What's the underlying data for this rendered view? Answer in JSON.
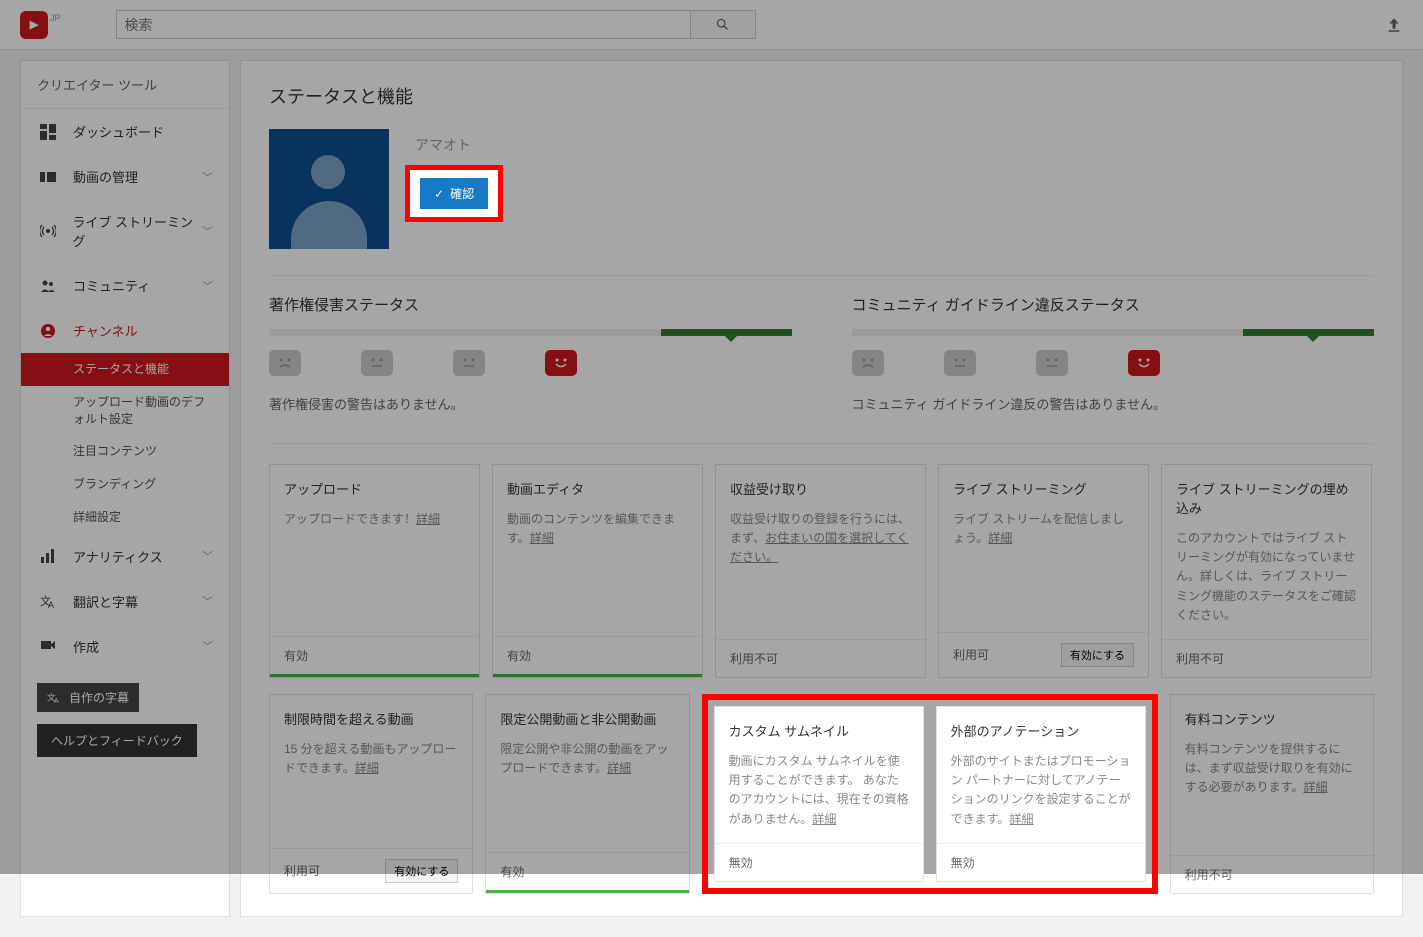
{
  "header": {
    "country": "JP",
    "search_placeholder": "検索"
  },
  "sidebar": {
    "title": "クリエイター ツール",
    "items": [
      {
        "label": "ダッシュボード"
      },
      {
        "label": "動画の管理"
      },
      {
        "label": "ライブ ストリーミング"
      },
      {
        "label": "コミュニティ"
      },
      {
        "label": "チャンネル"
      },
      {
        "label": "アナリティクス"
      },
      {
        "label": "翻訳と字幕"
      },
      {
        "label": "作成"
      }
    ],
    "channel_sub": [
      "ステータスと機能",
      "アップロード動画のデフォルト設定",
      "注目コンテンツ",
      "ブランディング",
      "詳細設定"
    ],
    "own_subs": "自作の字幕",
    "help": "ヘルプとフィードバック"
  },
  "main": {
    "title": "ステータスと機能",
    "username": "アマオト",
    "verify": "確認",
    "copyright": {
      "title": "著作権侵害ステータス",
      "msg": "著作権侵害の警告はありません。"
    },
    "community": {
      "title": "コミュニティ ガイドライン違反ステータス",
      "msg": "コミュニティ ガイドライン違反の警告はありません。"
    },
    "features_row1": [
      {
        "title": "アップロード",
        "desc": "アップロードできます！",
        "link": "詳細",
        "status": "有効",
        "enabled": true,
        "btn": ""
      },
      {
        "title": "動画エディタ",
        "desc": "動画のコンテンツを編集できます。",
        "link": "詳細",
        "status": "有効",
        "enabled": true,
        "btn": ""
      },
      {
        "title": "収益受け取り",
        "desc": "収益受け取りの登録を行うには、まず、",
        "link": "お住まいの国を選択してください。",
        "status": "利用不可",
        "enabled": false,
        "btn": ""
      },
      {
        "title": "ライブ ストリーミング",
        "desc": "ライブ ストリームを配信しましょう。",
        "link": "詳細",
        "status": "利用可",
        "enabled": false,
        "btn": "有効にする"
      },
      {
        "title": "ライブ ストリーミングの埋め込み",
        "desc": "このアカウントではライブ ストリーミングが有効になっていません。詳しくは、ライブ ストリーミング機能のステータスをご確認ください。",
        "link": "",
        "status": "利用不可",
        "enabled": false,
        "btn": ""
      }
    ],
    "features_row2_left": [
      {
        "title": "制限時間を超える動画",
        "desc": "15 分を超える動画もアップロードできます。",
        "link": "詳細",
        "status": "利用可",
        "enabled": false,
        "btn": "有効にする"
      },
      {
        "title": "限定公開動画と非公開動画",
        "desc": "限定公開や非公開の動画をアップロードできます。",
        "link": "詳細",
        "status": "有効",
        "enabled": true,
        "btn": ""
      }
    ],
    "features_callout": [
      {
        "title": "カスタム サムネイル",
        "desc": "動画にカスタム サムネイルを使用することができます。\nあなたのアカウントには、現在その資格がありません。",
        "link": "詳細",
        "status": "無効"
      },
      {
        "title": "外部のアノテーション",
        "desc": "外部のサイトまたはプロモーション パートナーに対してアノテーションのリンクを設定することができます。",
        "link": "詳細",
        "status": "無効"
      }
    ],
    "features_row2_right": [
      {
        "title": "有料コンテンツ",
        "desc": "有料コンテンツを提供するには、まず収益受け取りを有効にする必要があります。",
        "link": "詳細",
        "status": "利用不可",
        "enabled": false,
        "btn": ""
      }
    ]
  }
}
